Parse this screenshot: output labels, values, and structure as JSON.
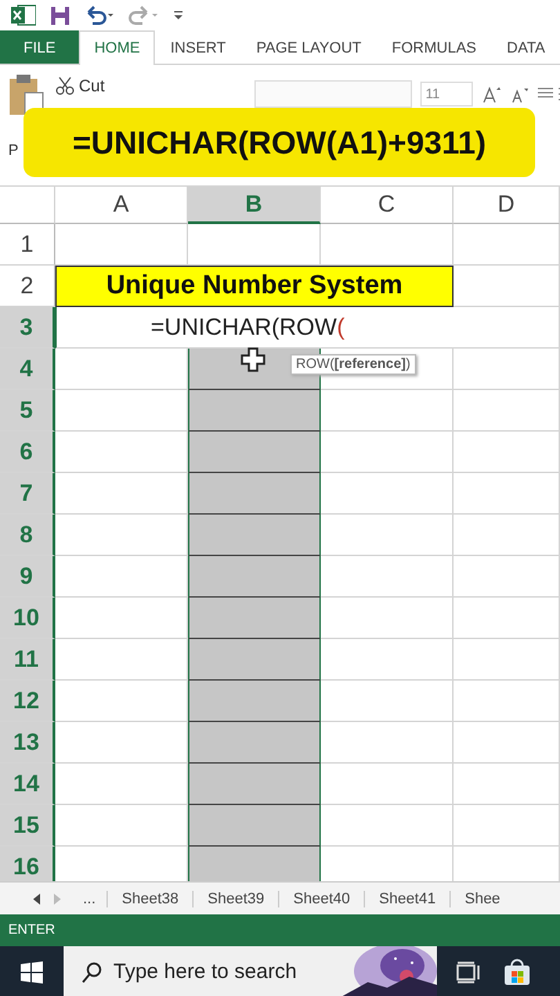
{
  "ribbon_tabs": [
    {
      "label": "FILE",
      "kind": "file",
      "selected": false
    },
    {
      "label": "HOME",
      "kind": "tab",
      "selected": true
    },
    {
      "label": "INSERT",
      "kind": "tab",
      "selected": false
    },
    {
      "label": "PAGE LAYOUT",
      "kind": "tab",
      "selected": false
    },
    {
      "label": "FORMULAS",
      "kind": "tab",
      "selected": false
    },
    {
      "label": "DATA",
      "kind": "tab",
      "selected": false
    }
  ],
  "ribbon": {
    "cut_label": "Cut",
    "paste_label": "P",
    "font_size": "11"
  },
  "banner": "=UNICHAR(ROW(A1)+9311)",
  "columns": [
    {
      "label": "A",
      "selected": false
    },
    {
      "label": "B",
      "selected": true
    },
    {
      "label": "C",
      "selected": false
    },
    {
      "label": "D",
      "selected": false
    }
  ],
  "rows": [
    {
      "number": "1",
      "selected": false
    },
    {
      "number": "2",
      "selected": false
    },
    {
      "number": "3",
      "selected": true
    },
    {
      "number": "4",
      "selected": true
    },
    {
      "number": "5",
      "selected": true
    },
    {
      "number": "6",
      "selected": true
    },
    {
      "number": "7",
      "selected": true
    },
    {
      "number": "8",
      "selected": true
    },
    {
      "number": "9",
      "selected": true
    },
    {
      "number": "10",
      "selected": true
    },
    {
      "number": "11",
      "selected": true
    },
    {
      "number": "12",
      "selected": true
    },
    {
      "number": "13",
      "selected": true
    },
    {
      "number": "14",
      "selected": true
    },
    {
      "number": "15",
      "selected": true
    },
    {
      "number": "16",
      "selected": true
    }
  ],
  "title_cell": {
    "text": "Unique Number System"
  },
  "edit_cell": {
    "text": "=UNICHAR(ROW",
    "open_paren": "("
  },
  "tooltip": "ROW(**[reference]**)",
  "sheet_tabs": [
    {
      "label": "...",
      "kind": "more"
    },
    {
      "label": "Sheet38",
      "kind": "sheet"
    },
    {
      "label": "Sheet39",
      "kind": "sheet"
    },
    {
      "label": "Sheet40",
      "kind": "sheet"
    },
    {
      "label": "Sheet41",
      "kind": "sheet"
    },
    {
      "label": "Shee",
      "kind": "sheet"
    }
  ],
  "status": "ENTER",
  "taskbar": {
    "search_placeholder": "Type here to search"
  }
}
